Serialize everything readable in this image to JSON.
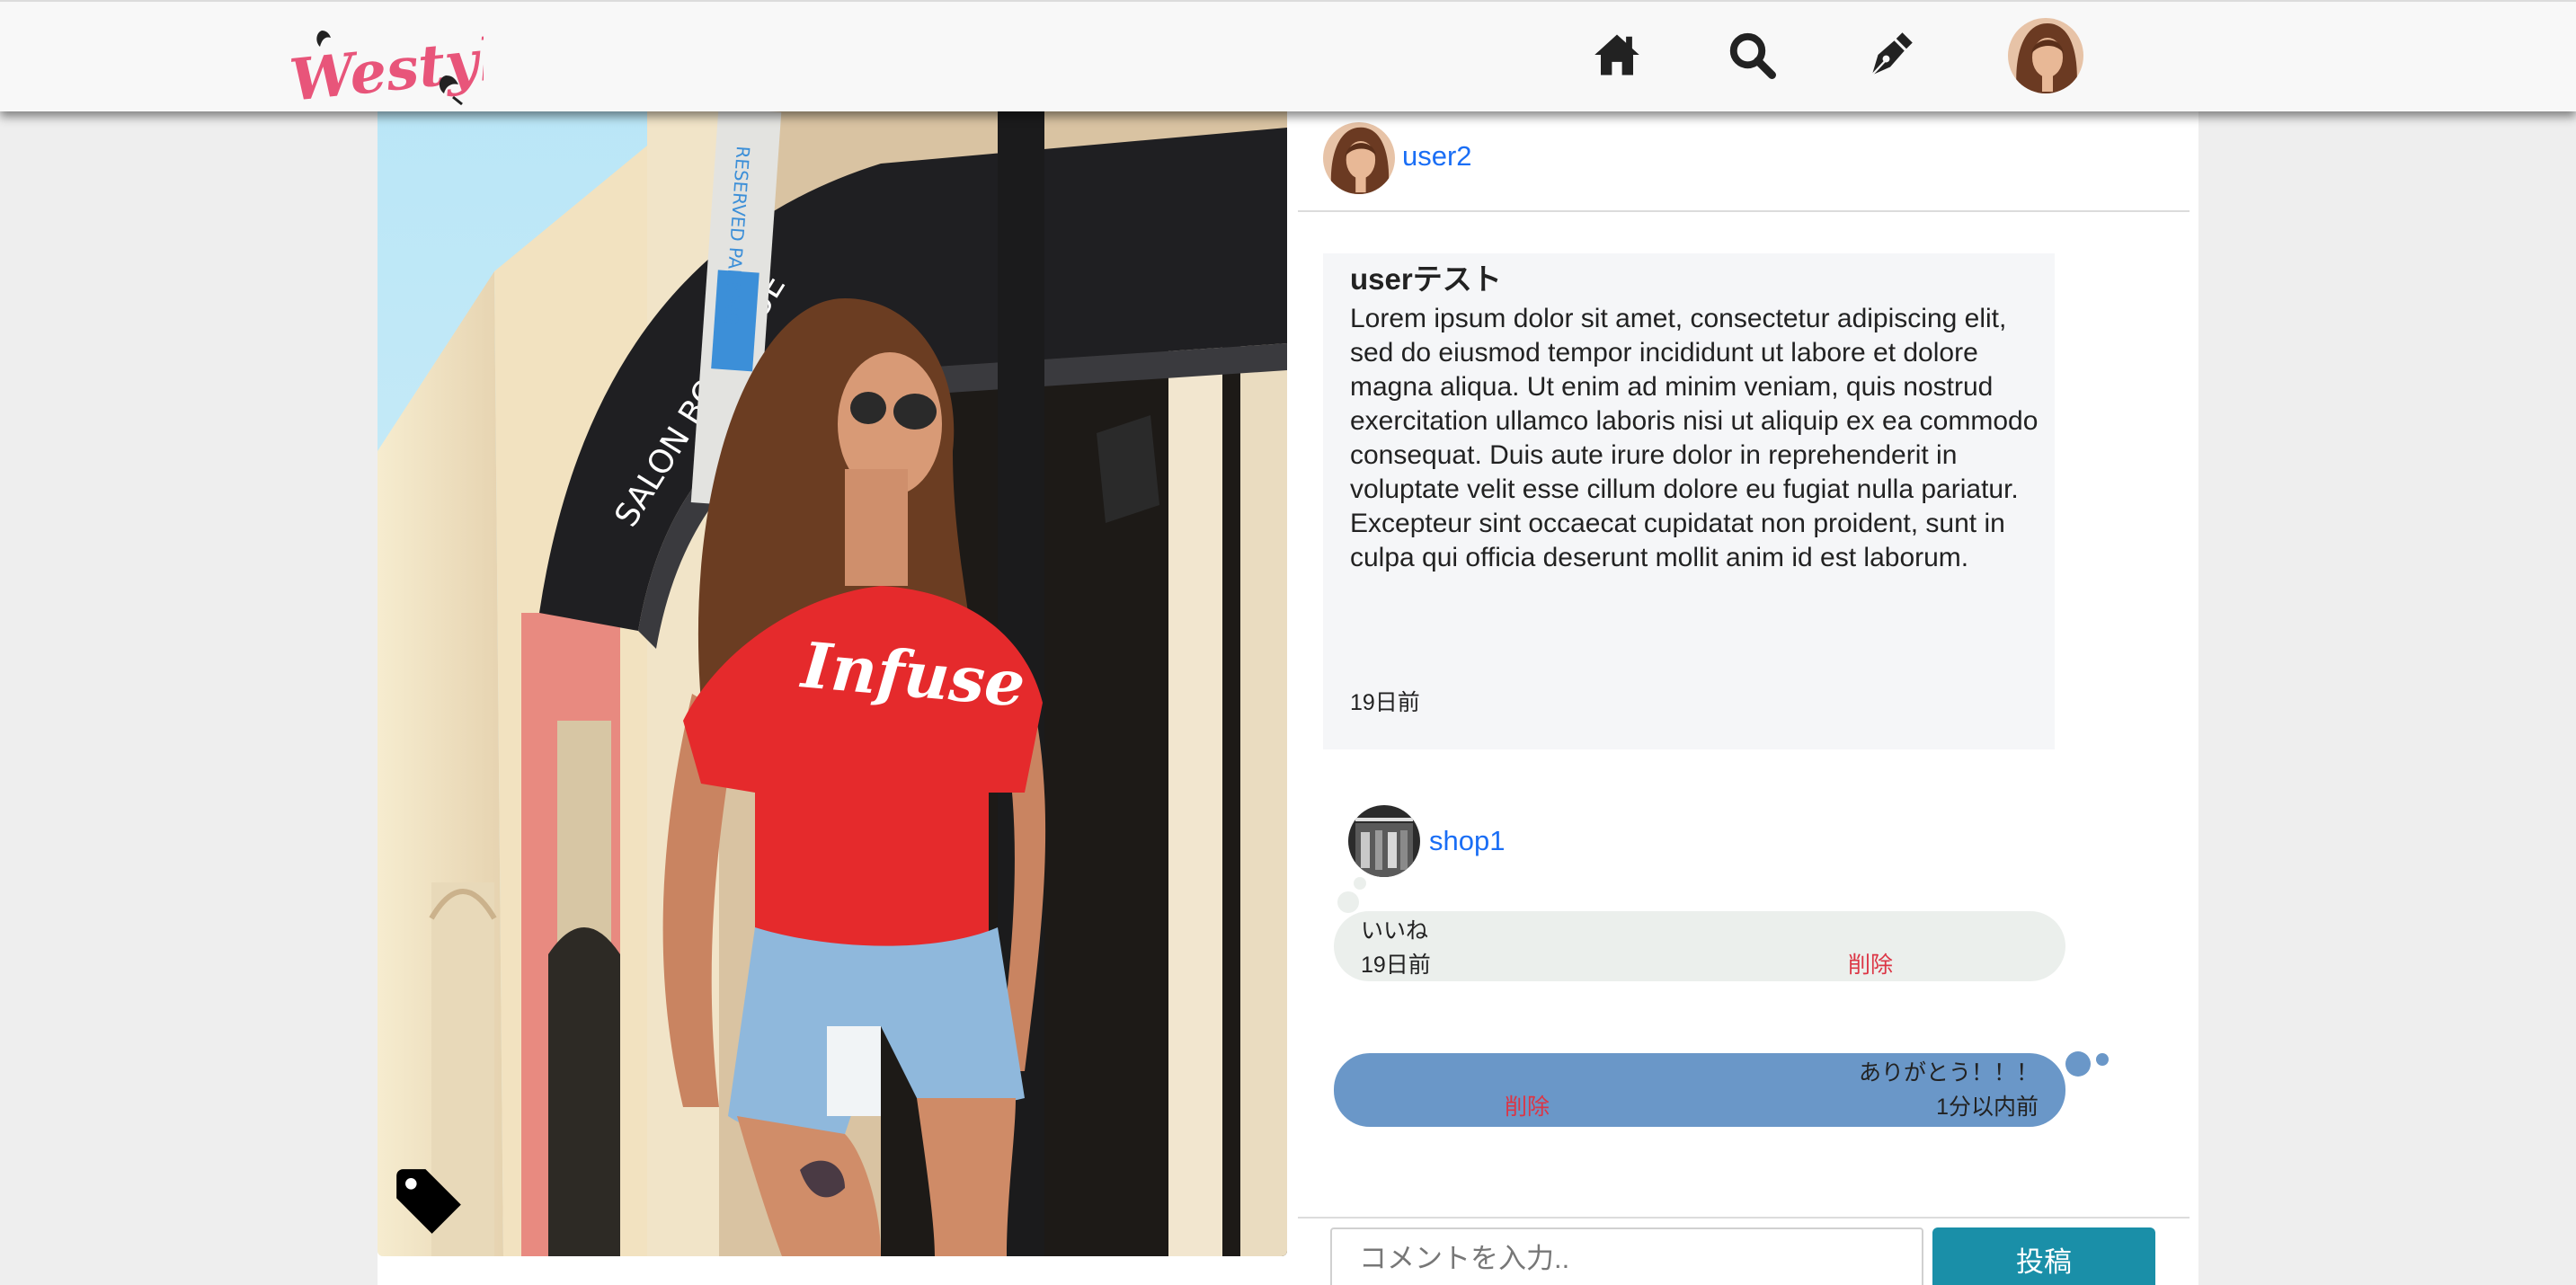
{
  "header": {
    "logo_text": "Westyle",
    "nav": [
      "home-icon",
      "search-icon",
      "pen-icon",
      "user-avatar"
    ]
  },
  "post": {
    "username": "user2",
    "title": "userテスト",
    "body": "Lorem ipsum dolor sit amet, consectetur adipiscing elit, sed do eiusmod tempor incididunt ut labore et dolore magna aliqua. Ut enim ad minim veniam, quis nostrud exercitation ullamco laboris nisi ut aliquip ex ea commodo consequat. Duis aute irure dolor in reprehenderit in voluptate velit esse cillum dolore eu fugiat nulla pariatur. Excepteur sint occaecat cupidatat non proident, sunt in culpa qui officia deserunt mollit anim id est laborum.",
    "time": "19日前",
    "image_text": {
      "shirt": "Infuse",
      "awning": "SALON BOUTIQUE",
      "sign": "RESERVED PARKING"
    }
  },
  "comments": [
    {
      "username": "shop1",
      "text": "いいね",
      "time": "19日前",
      "delete_label": "削除"
    },
    {
      "text": "ありがとう！！！",
      "time": "1分以内前",
      "delete_label": "削除"
    }
  ],
  "comment_form": {
    "placeholder": "コメントを入力..",
    "submit_label": "投稿"
  },
  "colors": {
    "link": "#1a6ef5",
    "delete": "#dc3545",
    "submit": "#1a8fa8",
    "bubble_other": "#ebefec",
    "bubble_self": "#6a97c8",
    "logo": "#e8557a"
  }
}
